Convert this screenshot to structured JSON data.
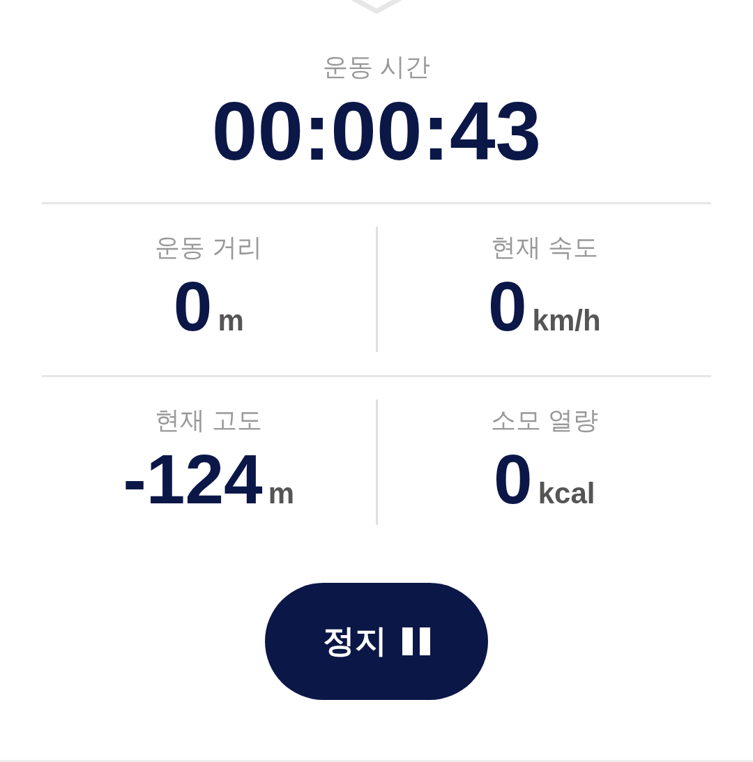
{
  "timer": {
    "label": "운동 시간",
    "value": "00:00:43"
  },
  "stats": [
    {
      "label": "운동 거리",
      "value": "0",
      "unit": "m"
    },
    {
      "label": "현재 속도",
      "value": "0",
      "unit": "km/h"
    },
    {
      "label": "현재 고도",
      "value": "-124",
      "unit": "m"
    },
    {
      "label": "소모 열량",
      "value": "0",
      "unit": "kcal"
    }
  ],
  "stop_button": {
    "label": "정지"
  }
}
